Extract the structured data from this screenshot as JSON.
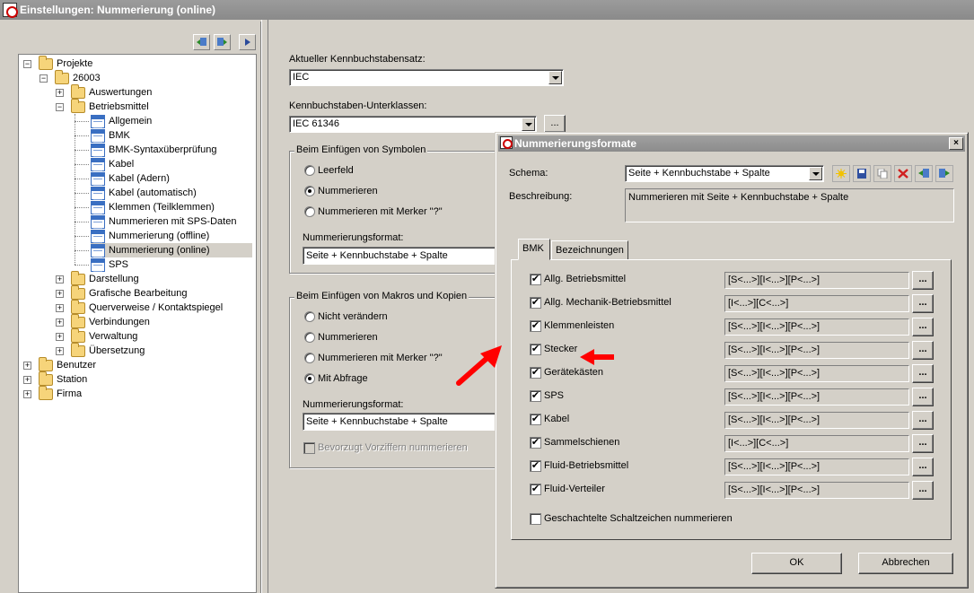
{
  "window": {
    "title": "Einstellungen: Nummerierung (online)"
  },
  "tree": {
    "items": [
      {
        "label": "Projekte",
        "level": 0,
        "icon": "folder-icon",
        "expander": "−"
      },
      {
        "label": "26003",
        "level": 1,
        "icon": "folder-icon",
        "expander": "−"
      },
      {
        "label": "Auswertungen",
        "level": 2,
        "icon": "folder-icon",
        "expander": "+"
      },
      {
        "label": "Betriebsmittel",
        "level": 2,
        "icon": "folder-icon",
        "expander": "−"
      },
      {
        "label": "Allgemein",
        "level": 3,
        "icon": "settings-doc-icon"
      },
      {
        "label": "BMK",
        "level": 3,
        "icon": "settings-doc-icon"
      },
      {
        "label": "BMK-Syntaxüberprüfung",
        "level": 3,
        "icon": "settings-doc-icon"
      },
      {
        "label": "Kabel",
        "level": 3,
        "icon": "settings-doc-icon"
      },
      {
        "label": "Kabel (Adern)",
        "level": 3,
        "icon": "settings-doc-icon"
      },
      {
        "label": "Kabel (automatisch)",
        "level": 3,
        "icon": "settings-doc-icon"
      },
      {
        "label": "Klemmen (Teilklemmen)",
        "level": 3,
        "icon": "settings-doc-icon"
      },
      {
        "label": "Nummerieren mit SPS-Daten",
        "level": 3,
        "icon": "settings-doc-icon"
      },
      {
        "label": "Nummerierung (offline)",
        "level": 3,
        "icon": "settings-doc-icon"
      },
      {
        "label": "Nummerierung (online)",
        "level": 3,
        "icon": "settings-doc-icon",
        "selected": true
      },
      {
        "label": "SPS",
        "level": 3,
        "icon": "settings-doc-icon"
      },
      {
        "label": "Darstellung",
        "level": 2,
        "icon": "folder-icon",
        "expander": "+"
      },
      {
        "label": "Grafische Bearbeitung",
        "level": 2,
        "icon": "folder-icon",
        "expander": "+"
      },
      {
        "label": "Querverweise / Kontaktspiegel",
        "level": 2,
        "icon": "folder-icon",
        "expander": "+"
      },
      {
        "label": "Verbindungen",
        "level": 2,
        "icon": "folder-icon",
        "expander": "+"
      },
      {
        "label": "Verwaltung",
        "level": 2,
        "icon": "folder-icon",
        "expander": "+"
      },
      {
        "label": "Übersetzung",
        "level": 2,
        "icon": "folder-icon",
        "expander": "+"
      },
      {
        "label": "Benutzer",
        "level": 0,
        "icon": "folder-icon",
        "expander": "+"
      },
      {
        "label": "Station",
        "level": 0,
        "icon": "folder-icon",
        "expander": "+"
      },
      {
        "label": "Firma",
        "level": 0,
        "icon": "folder-icon",
        "expander": "+"
      }
    ]
  },
  "settings": {
    "kennbuchstabensatz_label": "Aktueller Kennbuchstabensatz:",
    "kennbuchstabensatz_value": "IEC",
    "unterklassen_label": "Kennbuchstaben-Unterklassen:",
    "unterklassen_value": "IEC 61346",
    "dots_label": "...",
    "symbole_group": {
      "title": "Beim Einfügen von Symbolen",
      "options": [
        "Leerfeld",
        "Nummerieren",
        "Nummerieren mit Merker \"?\""
      ],
      "selected_index": 1,
      "format_label": "Nummerierungsformat:",
      "format_value": "Seite + Kennbuchstabe + Spalte"
    },
    "makros_group": {
      "title": "Beim Einfügen von Makros und Kopien",
      "options": [
        "Nicht verändern",
        "Nummerieren",
        "Nummerieren mit Merker \"?\"",
        "Mit Abfrage"
      ],
      "selected_index": 3,
      "format_label": "Nummerierungsformat:",
      "format_value": "Seite + Kennbuchstabe + Spalte",
      "vorziffern_label": "Bevorzugt Vorziffern nummerieren"
    }
  },
  "dialog": {
    "title": "Nummerierungsformate",
    "close_label": "×",
    "schema_label": "Schema:",
    "schema_value": "Seite + Kennbuchstabe + Spalte",
    "beschreibung_label": "Beschreibung:",
    "beschreibung_value": "Nummerieren mit Seite + Kennbuchstabe + Spalte",
    "toolbar_icons": [
      "new-icon",
      "save-icon",
      "copy-icon",
      "delete-icon",
      "import-icon",
      "export-icon"
    ],
    "tabs": [
      "BMK",
      "Bezeichnungen"
    ],
    "active_tab": 0,
    "rows": [
      {
        "label": "Allg. Betriebsmittel",
        "checked": true,
        "format": "[S<...>][I<...>][P<...>]"
      },
      {
        "label": "Allg. Mechanik-Betriebsmittel",
        "checked": true,
        "format": "[I<...>][C<...>]"
      },
      {
        "label": "Klemmenleisten",
        "checked": true,
        "format": "[S<...>][I<...>][P<...>]"
      },
      {
        "label": "Stecker",
        "checked": true,
        "format": "[S<...>][I<...>][P<...>]"
      },
      {
        "label": "Gerätekästen",
        "checked": true,
        "format": "[S<...>][I<...>][P<...>]"
      },
      {
        "label": "SPS",
        "checked": true,
        "format": "[S<...>][I<...>][P<...>]"
      },
      {
        "label": "Kabel",
        "checked": true,
        "format": "[S<...>][I<...>][P<...>]"
      },
      {
        "label": "Sammelschienen",
        "checked": true,
        "format": "[I<...>][C<...>]"
      },
      {
        "label": "Fluid-Betriebsmittel",
        "checked": true,
        "format": "[S<...>][I<...>][P<...>]"
      },
      {
        "label": "Fluid-Verteiler",
        "checked": true,
        "format": "[S<...>][I<...>][P<...>]"
      }
    ],
    "nested_label": "Geschachtelte Schaltzeichen nummerieren",
    "ok_label": "OK",
    "cancel_label": "Abbrechen",
    "checkmark": "✔",
    "dots_label": "..."
  },
  "colors": {
    "arrow": "#ff0000"
  }
}
